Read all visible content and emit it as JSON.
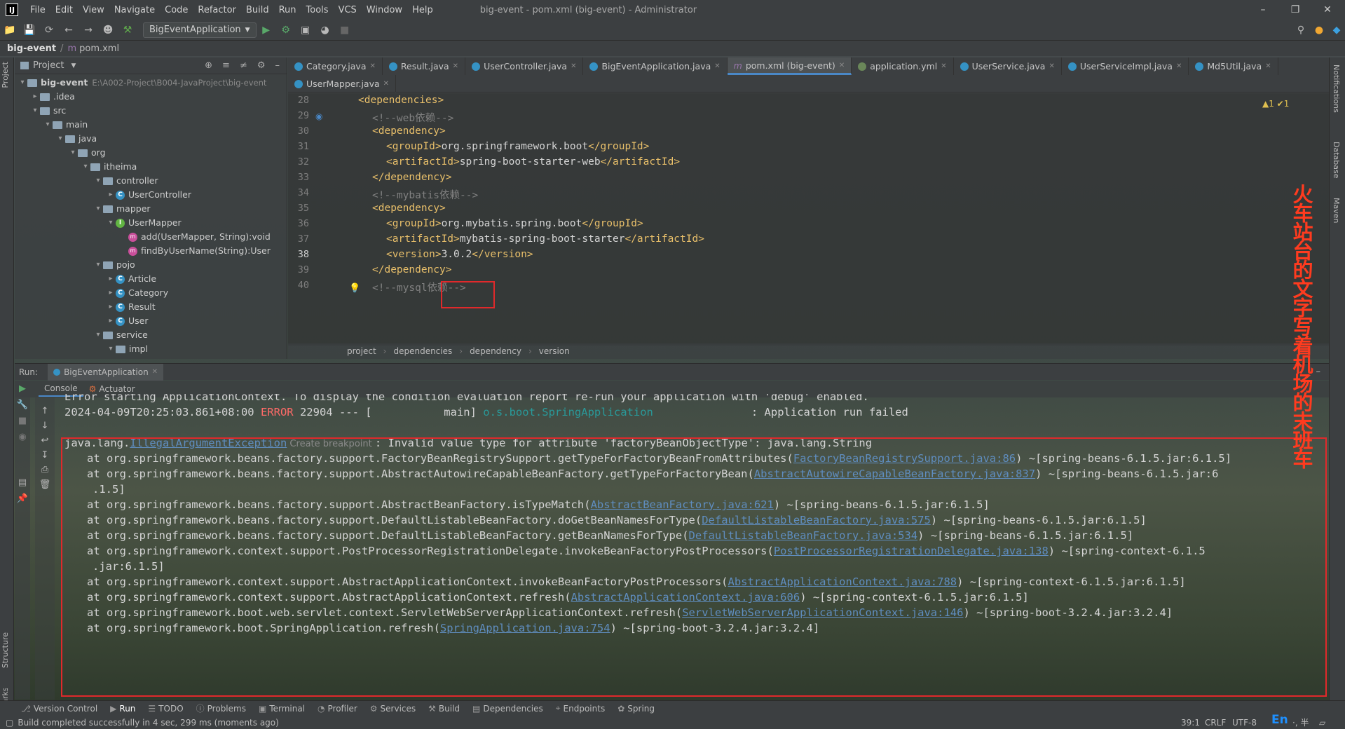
{
  "menubar": {
    "logo": "IJ",
    "items": [
      "File",
      "Edit",
      "View",
      "Navigate",
      "Code",
      "Refactor",
      "Build",
      "Run",
      "Tools",
      "VCS",
      "Window",
      "Help"
    ],
    "title": "big-event - pom.xml (big-event) - Administrator"
  },
  "toolbar": {
    "run_config": "BigEventApplication"
  },
  "breadcrumb": {
    "project": "big-event",
    "file": "pom.xml"
  },
  "project_panel": {
    "title": "Project",
    "tree": [
      {
        "label": "big-event",
        "extra": "E:\\A002-Project\\B004-JavaProject\\big-event",
        "kind": "folder",
        "depth": 0,
        "arrow": "v"
      },
      {
        "label": ".idea",
        "kind": "folder",
        "depth": 1,
        "arrow": ">"
      },
      {
        "label": "src",
        "kind": "folder",
        "depth": 1,
        "arrow": "v"
      },
      {
        "label": "main",
        "kind": "folder",
        "depth": 2,
        "arrow": "v"
      },
      {
        "label": "java",
        "kind": "folder",
        "depth": 3,
        "arrow": "v"
      },
      {
        "label": "org",
        "kind": "folder",
        "depth": 4,
        "arrow": "v"
      },
      {
        "label": "itheima",
        "kind": "folder",
        "depth": 5,
        "arrow": "v"
      },
      {
        "label": "controller",
        "kind": "folder",
        "depth": 6,
        "arrow": "v"
      },
      {
        "label": "UserController",
        "kind": "class",
        "depth": 7,
        "arrow": ">"
      },
      {
        "label": "mapper",
        "kind": "folder",
        "depth": 6,
        "arrow": "v"
      },
      {
        "label": "UserMapper",
        "kind": "interface",
        "depth": 7,
        "arrow": "v"
      },
      {
        "label": "add(UserMapper, String):void",
        "kind": "method",
        "depth": 8,
        "arrow": ""
      },
      {
        "label": "findByUserName(String):User",
        "kind": "method",
        "depth": 8,
        "arrow": ""
      },
      {
        "label": "pojo",
        "kind": "folder",
        "depth": 6,
        "arrow": "v"
      },
      {
        "label": "Article",
        "kind": "class",
        "depth": 7,
        "arrow": ">"
      },
      {
        "label": "Category",
        "kind": "class",
        "depth": 7,
        "arrow": ">"
      },
      {
        "label": "Result",
        "kind": "class",
        "depth": 7,
        "arrow": ">"
      },
      {
        "label": "User",
        "kind": "class",
        "depth": 7,
        "arrow": ">"
      },
      {
        "label": "service",
        "kind": "folder",
        "depth": 6,
        "arrow": "v"
      },
      {
        "label": "impl",
        "kind": "folder",
        "depth": 7,
        "arrow": "v"
      }
    ]
  },
  "editor_tabs": [
    {
      "label": "Category.java",
      "active": false
    },
    {
      "label": "Result.java",
      "active": false
    },
    {
      "label": "UserController.java",
      "active": false
    },
    {
      "label": "BigEventApplication.java",
      "active": false
    },
    {
      "label": "pom.xml (big-event)",
      "active": true
    },
    {
      "label": "application.yml",
      "active": false
    },
    {
      "label": "UserService.java",
      "active": false
    },
    {
      "label": "UserServiceImpl.java",
      "active": false
    },
    {
      "label": "Md5Util.java",
      "active": false
    },
    {
      "label": "UserMapper.java",
      "active": false
    }
  ],
  "editor": {
    "inspection": "▲1 ✔1",
    "lines": [
      {
        "n": "28",
        "indent": 0,
        "parts": [
          [
            "tag",
            "<dependencies>"
          ]
        ]
      },
      {
        "n": "29",
        "indent": 1,
        "parts": [
          [
            "cm",
            "<!--web依赖-->"
          ]
        ]
      },
      {
        "n": "30",
        "indent": 1,
        "parts": [
          [
            "tag",
            "<dependency>"
          ]
        ]
      },
      {
        "n": "31",
        "indent": 2,
        "parts": [
          [
            "tag",
            "<groupId>"
          ],
          [
            "txt",
            "org.springframework.boot"
          ],
          [
            "tag",
            "</groupId>"
          ]
        ]
      },
      {
        "n": "32",
        "indent": 2,
        "parts": [
          [
            "tag",
            "<artifactId>"
          ],
          [
            "txt",
            "spring-boot-starter-web"
          ],
          [
            "tag",
            "</artifactId>"
          ]
        ]
      },
      {
        "n": "33",
        "indent": 1,
        "parts": [
          [
            "tag",
            "</dependency>"
          ]
        ]
      },
      {
        "n": "34",
        "indent": 1,
        "parts": [
          [
            "cm",
            "<!--mybatis依赖-->"
          ]
        ]
      },
      {
        "n": "35",
        "indent": 1,
        "parts": [
          [
            "tag",
            "<dependency>"
          ]
        ]
      },
      {
        "n": "36",
        "indent": 2,
        "parts": [
          [
            "tag",
            "<groupId>"
          ],
          [
            "txt",
            "org.mybatis.spring.boot"
          ],
          [
            "tag",
            "</groupId>"
          ]
        ]
      },
      {
        "n": "37",
        "indent": 2,
        "parts": [
          [
            "tag",
            "<artifactId>"
          ],
          [
            "txt",
            "mybatis-spring-boot-starter"
          ],
          [
            "tag",
            "</artifactId>"
          ]
        ]
      },
      {
        "n": "38",
        "indent": 2,
        "parts": [
          [
            "tag",
            "<version>"
          ],
          [
            "txt",
            "3.0.2"
          ],
          [
            "tag",
            "</version>"
          ]
        ]
      },
      {
        "n": "39",
        "indent": 1,
        "parts": [
          [
            "tag",
            "</dependency>"
          ]
        ]
      },
      {
        "n": "40",
        "indent": 1,
        "parts": [
          [
            "cm",
            "<!--mysql依赖-->"
          ]
        ]
      }
    ],
    "breadcrumb": [
      "project",
      "dependencies",
      "dependency",
      "version"
    ]
  },
  "run": {
    "label": "Run:",
    "config": "BigEventApplication",
    "tabs": [
      "Console",
      "Actuator"
    ],
    "console": [
      {
        "parts": [
          [
            "txt",
            "Error starting ApplicationContext. To display the condition evaluation report re-run your application with 'debug' enabled."
          ]
        ],
        "indent": 0
      },
      {
        "parts": [
          [
            "txt",
            "2024-04-09T20:25:03.861+08:00 "
          ],
          [
            "err",
            "ERROR"
          ],
          [
            "txt",
            " 22904 --- [           main] "
          ],
          [
            "cls2",
            "o.s.boot.SpringApplication"
          ],
          [
            "txt",
            "               : Application run failed"
          ]
        ],
        "indent": 0
      },
      {
        "parts": [
          [
            "txt",
            ""
          ]
        ],
        "indent": 0
      },
      {
        "parts": [
          [
            "txt",
            "java.lang."
          ],
          [
            "lnk",
            "IllegalArgumentException"
          ],
          [
            "cm",
            " Create breakpoint "
          ],
          [
            "txt",
            ": Invalid value type for attribute 'factoryBeanObjectType': java.lang.String"
          ]
        ],
        "indent": 0
      },
      {
        "parts": [
          [
            "txt",
            "at org.springframework.beans.factory.support.FactoryBeanRegistrySupport.getTypeForFactoryBeanFromAttributes("
          ],
          [
            "lnk",
            "FactoryBeanRegistrySupport.java:86"
          ],
          [
            "txt",
            ") ~[spring-beans-6.1.5.jar:6.1.5]"
          ]
        ],
        "indent": 1
      },
      {
        "parts": [
          [
            "txt",
            "at org.springframework.beans.factory.support.AbstractAutowireCapableBeanFactory.getTypeForFactoryBean("
          ],
          [
            "lnk",
            "AbstractAutowireCapableBeanFactory.java:837"
          ],
          [
            "txt",
            ") ~[spring-beans-6.1.5.jar:6"
          ]
        ],
        "indent": 1
      },
      {
        "parts": [
          [
            "txt",
            ".1.5]"
          ]
        ],
        "indent": 2
      },
      {
        "parts": [
          [
            "txt",
            "at org.springframework.beans.factory.support.AbstractBeanFactory.isTypeMatch("
          ],
          [
            "lnk",
            "AbstractBeanFactory.java:621"
          ],
          [
            "txt",
            ") ~[spring-beans-6.1.5.jar:6.1.5]"
          ]
        ],
        "indent": 1
      },
      {
        "parts": [
          [
            "txt",
            "at org.springframework.beans.factory.support.DefaultListableBeanFactory.doGetBeanNamesForType("
          ],
          [
            "lnk",
            "DefaultListableBeanFactory.java:575"
          ],
          [
            "txt",
            ") ~[spring-beans-6.1.5.jar:6.1.5]"
          ]
        ],
        "indent": 1
      },
      {
        "parts": [
          [
            "txt",
            "at org.springframework.beans.factory.support.DefaultListableBeanFactory.getBeanNamesForType("
          ],
          [
            "lnk",
            "DefaultListableBeanFactory.java:534"
          ],
          [
            "txt",
            ") ~[spring-beans-6.1.5.jar:6.1.5]"
          ]
        ],
        "indent": 1
      },
      {
        "parts": [
          [
            "txt",
            "at org.springframework.context.support.PostProcessorRegistrationDelegate.invokeBeanFactoryPostProcessors("
          ],
          [
            "lnk",
            "PostProcessorRegistrationDelegate.java:138"
          ],
          [
            "txt",
            ") ~[spring-context-6.1.5"
          ]
        ],
        "indent": 1
      },
      {
        "parts": [
          [
            "txt",
            ".jar:6.1.5]"
          ]
        ],
        "indent": 2
      },
      {
        "parts": [
          [
            "txt",
            "at org.springframework.context.support.AbstractApplicationContext.invokeBeanFactoryPostProcessors("
          ],
          [
            "lnk",
            "AbstractApplicationContext.java:788"
          ],
          [
            "txt",
            ") ~[spring-context-6.1.5.jar:6.1.5]"
          ]
        ],
        "indent": 1
      },
      {
        "parts": [
          [
            "txt",
            "at org.springframework.context.support.AbstractApplicationContext.refresh("
          ],
          [
            "lnk",
            "AbstractApplicationContext.java:606"
          ],
          [
            "txt",
            ") ~[spring-context-6.1.5.jar:6.1.5]"
          ]
        ],
        "indent": 1
      },
      {
        "parts": [
          [
            "txt",
            "at org.springframework.boot.web.servlet.context.ServletWebServerApplicationContext.refresh("
          ],
          [
            "lnk",
            "ServletWebServerApplicationContext.java:146"
          ],
          [
            "txt",
            ") ~[spring-boot-3.2.4.jar:3.2.4]"
          ]
        ],
        "indent": 1
      },
      {
        "parts": [
          [
            "txt",
            "at org.springframework.boot.SpringApplication.refresh("
          ],
          [
            "lnk",
            "SpringApplication.java:754"
          ],
          [
            "txt",
            ") ~[spring-boot-3.2.4.jar:3.2.4]"
          ]
        ],
        "indent": 1
      }
    ]
  },
  "bottom_tabs": [
    "Version Control",
    "Run",
    "TODO",
    "Problems",
    "Terminal",
    "Profiler",
    "Services",
    "Build",
    "Dependencies",
    "Endpoints",
    "Spring"
  ],
  "status": {
    "message": "Build completed successfully in 4 sec, 299 ms (moments ago)",
    "position": "39:1",
    "line_sep": "CRLF",
    "encoding": "UTF-8",
    "ime": "En",
    "ime_extra": "·, 半"
  },
  "side_tabs": {
    "left": [
      "Project",
      "Structure",
      "Bookmarks"
    ],
    "right": [
      "Notifications",
      "Database",
      "Maven"
    ]
  },
  "overlay_note": "火车站台的文字写着机场的末班车"
}
